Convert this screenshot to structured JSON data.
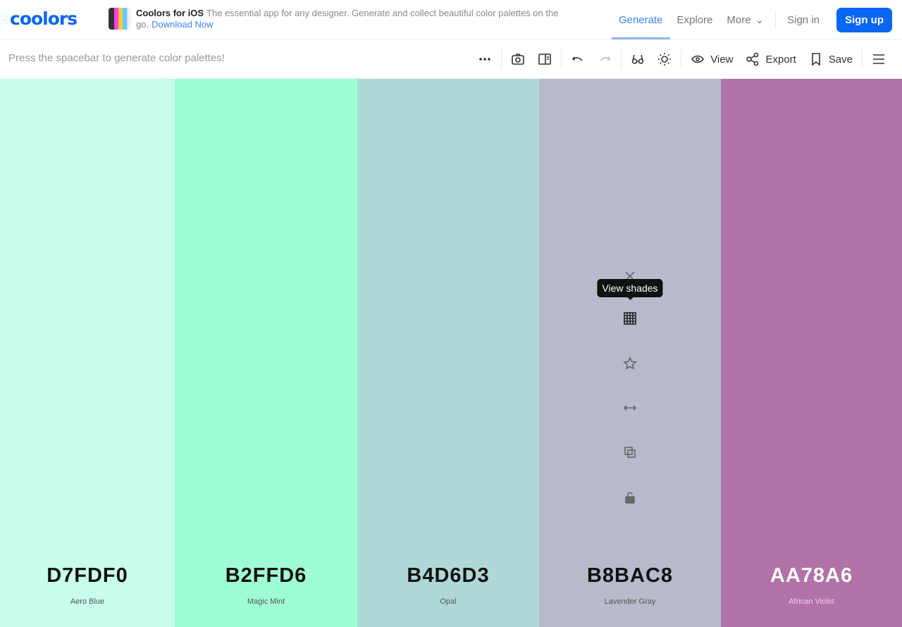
{
  "nav": {
    "logo": "coolors",
    "promo_title": "Coolors for iOS",
    "promo_text": "The essential app for any designer. Generate and collect beautiful color palettes on the go.",
    "promo_link": "Download Now",
    "links": [
      "Generate",
      "Explore",
      "More"
    ],
    "sign_in": "Sign in",
    "sign_up": "Sign up",
    "accent": "#0a66f5"
  },
  "toolbar": {
    "hint": "Press the spacebar to generate color palettes!",
    "view": "View",
    "export": "Export",
    "save": "Save"
  },
  "palette": [
    {
      "hex": "D7FDF0",
      "name": "Aero Blue",
      "shown": "#c8fdeb"
    },
    {
      "hex": "B2FFD6",
      "name": "Magic Mint",
      "shown": "#9ffdd5"
    },
    {
      "hex": "B4D6D3",
      "name": "Opal",
      "shown": "#add8d5"
    },
    {
      "hex": "B8BAC8",
      "name": "Lavender Gray",
      "shown": "#b8bacb"
    },
    {
      "hex": "AA78A6",
      "name": "African Violet",
      "shown": "#b172a8"
    }
  ],
  "tooltip": "View shades"
}
